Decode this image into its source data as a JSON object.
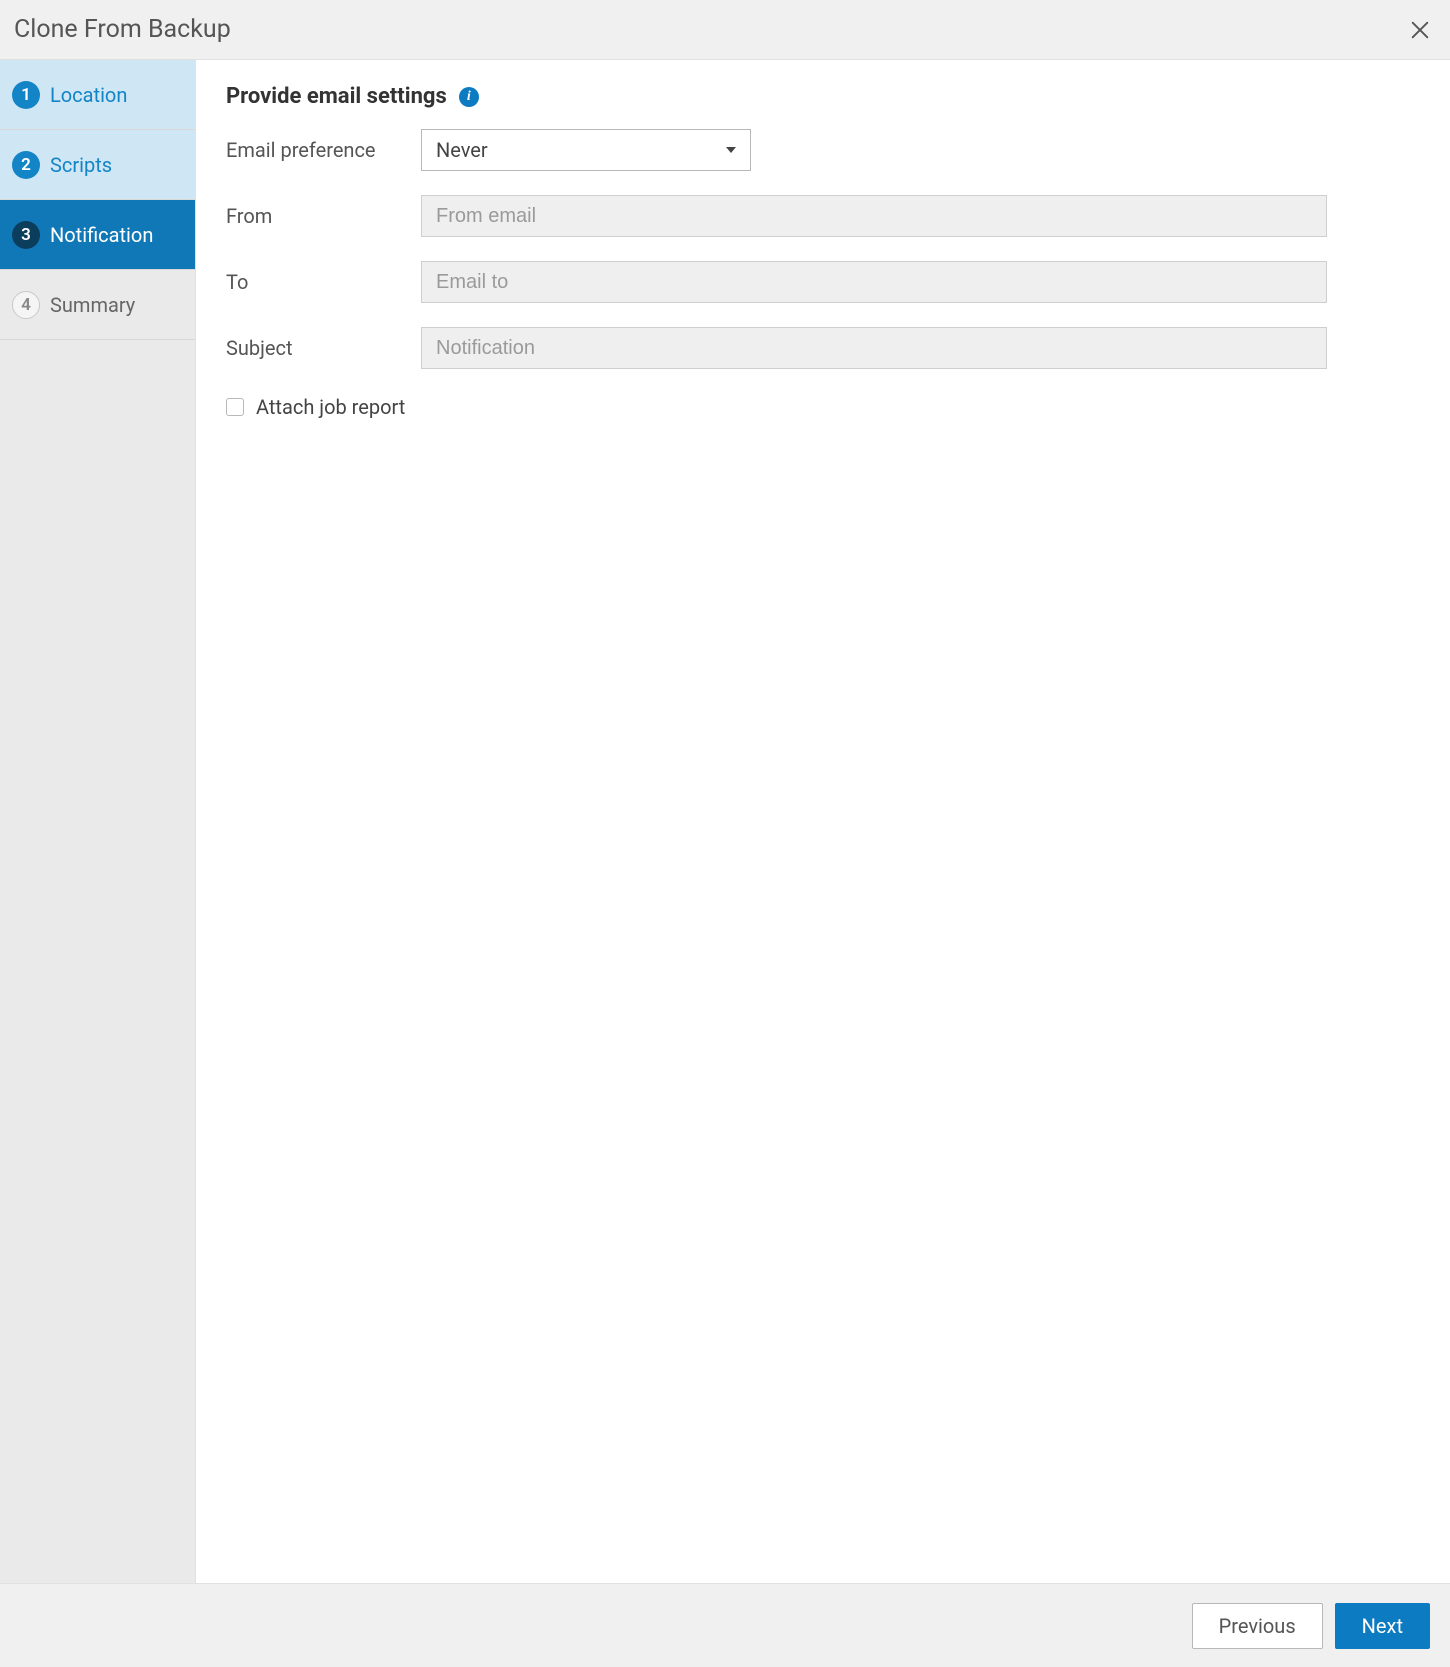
{
  "dialog": {
    "title": "Clone From Backup"
  },
  "steps": [
    {
      "num": "1",
      "label": "Location",
      "state": "completed"
    },
    {
      "num": "2",
      "label": "Scripts",
      "state": "completed"
    },
    {
      "num": "3",
      "label": "Notification",
      "state": "active"
    },
    {
      "num": "4",
      "label": "Summary",
      "state": "pending"
    }
  ],
  "content": {
    "heading": "Provide email settings",
    "fields": {
      "email_preference": {
        "label": "Email preference",
        "value": "Never"
      },
      "from": {
        "label": "From",
        "placeholder": "From email",
        "value": ""
      },
      "to": {
        "label": "To",
        "placeholder": "Email to",
        "value": ""
      },
      "subject": {
        "label": "Subject",
        "placeholder": "Notification",
        "value": ""
      }
    },
    "attach_job_report": {
      "label": "Attach job report",
      "checked": false
    }
  },
  "footer": {
    "previous": "Previous",
    "next": "Next"
  }
}
